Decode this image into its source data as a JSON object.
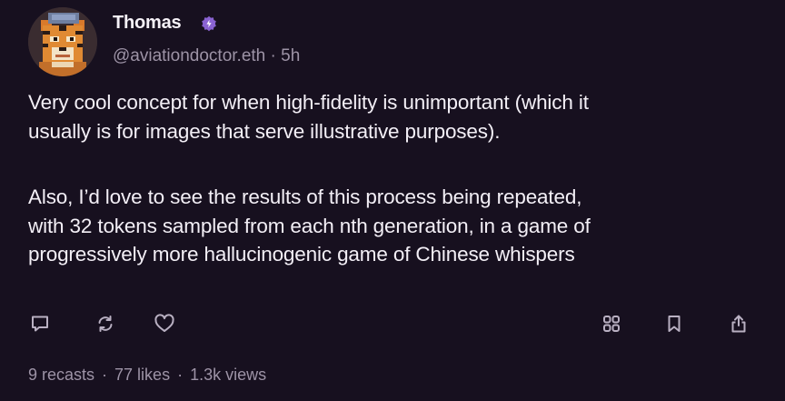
{
  "post": {
    "author": {
      "name": "Thomas",
      "handle": "@aviationdoctor.eth",
      "time_separator": "·",
      "timestamp": "5h",
      "verified": true,
      "avatar_icon": "tiger-pixel-avatar"
    },
    "body": {
      "paragraph_1_line_1": "Very cool concept for when high-fidelity is unimportant (which it",
      "paragraph_1_line_2": "usually is for images that serve illustrative purposes).",
      "paragraph_2_line_1": "Also, I’d love to see the results of this process being repeated,",
      "paragraph_2_line_2": "with 32 tokens sampled from each nth generation, in a game of",
      "paragraph_2_line_3": "progressively more hallucinogenic game of Chinese whispers"
    },
    "actions": {
      "left": [
        "comment-icon",
        "recast-icon",
        "like-icon"
      ],
      "right": [
        "grid-icon",
        "bookmark-icon",
        "share-icon"
      ]
    },
    "stats": {
      "recasts": "9 recasts",
      "likes": "77 likes",
      "views": "1.3k views",
      "separator": "·"
    }
  },
  "colors": {
    "background": "#17101f",
    "text_primary": "#f3eff6",
    "text_secondary": "#9d93a6",
    "verified_badge": "#8a63d2",
    "icon": "#b9b0c2"
  }
}
